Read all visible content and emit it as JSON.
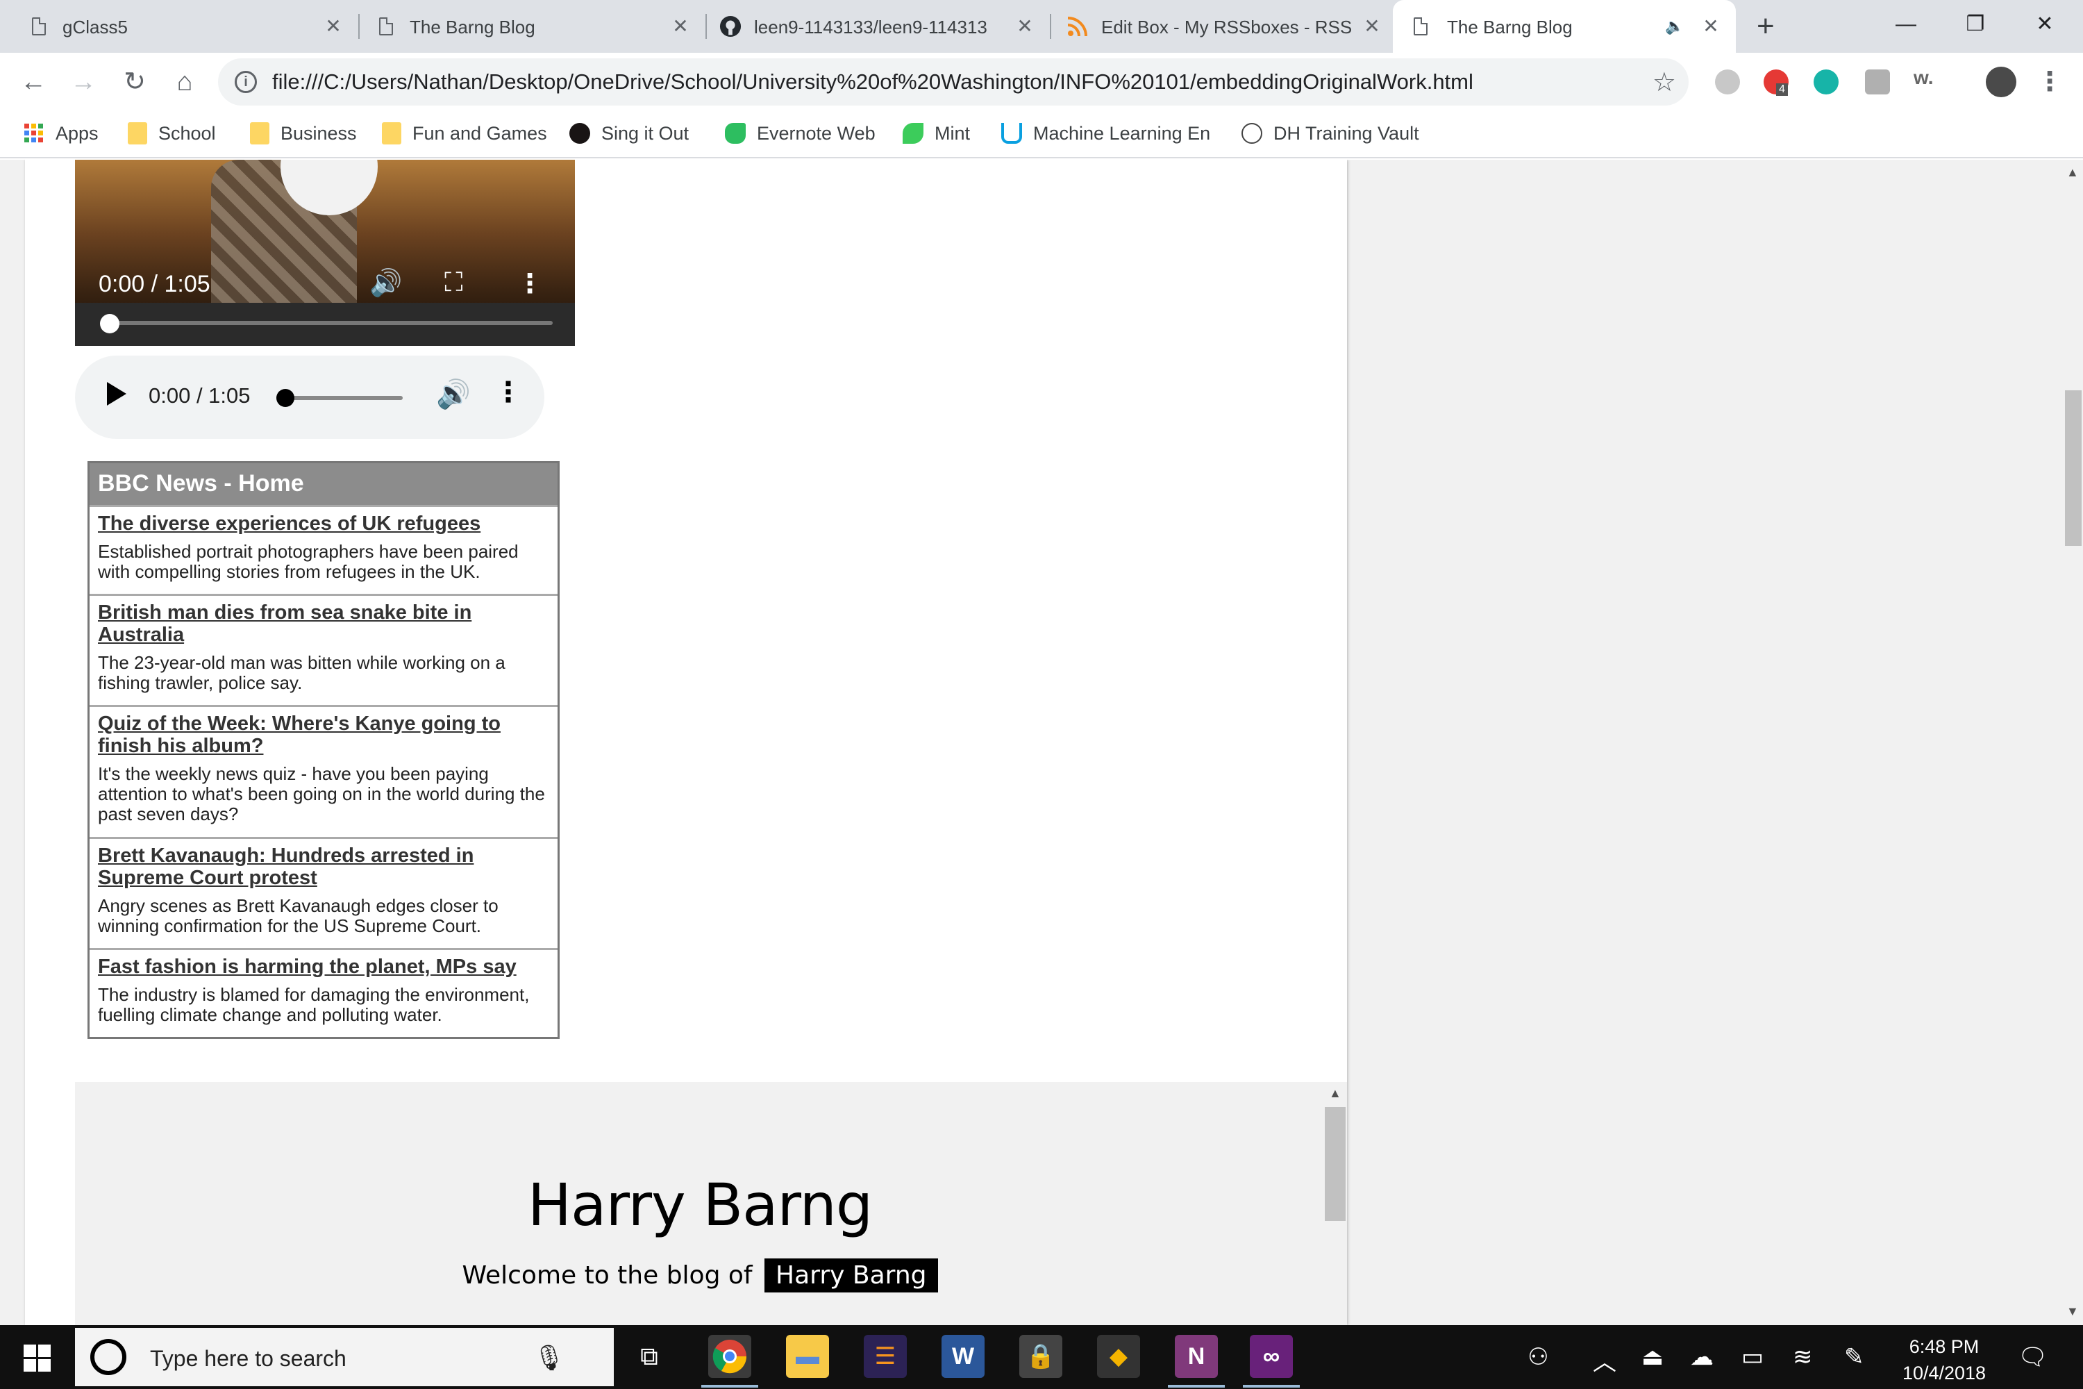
{
  "tabs": [
    {
      "title": "gClass5"
    },
    {
      "title": "The Barng Blog"
    },
    {
      "title": "leen9-1143133/leen9-114313"
    },
    {
      "title": "Edit Box - My RSSboxes - RSS"
    },
    {
      "title": "The Barng Blog"
    }
  ],
  "address_bar": {
    "url": "file:///C:/Users/Nathan/Desktop/OneDrive/School/University%20of%20Washington/INFO%20101/embeddingOriginalWork.html"
  },
  "bookmarks": [
    {
      "label": "Apps"
    },
    {
      "label": "School"
    },
    {
      "label": "Business"
    },
    {
      "label": "Fun and Games"
    },
    {
      "label": "Sing it Out"
    },
    {
      "label": "Evernote Web"
    },
    {
      "label": "Mint"
    },
    {
      "label": "Machine Learning En"
    },
    {
      "label": "DH Training Vault"
    }
  ],
  "extensions": {
    "badge_count": "4",
    "w_label": "w."
  },
  "video": {
    "time": "0:00 / 1:05",
    "progress": 0.0
  },
  "audio": {
    "time": "0:00 / 1:05",
    "progress": 0.0
  },
  "rss": {
    "title": "BBC News - Home",
    "items": [
      {
        "title": "The diverse experiences of UK refugees",
        "desc": "Established portrait photographers have been paired with compelling stories from refugees in the UK."
      },
      {
        "title": "British man dies from sea snake bite in Australia",
        "desc": "The 23-year-old man was bitten while working on a fishing trawler, police say."
      },
      {
        "title": "Quiz of the Week: Where's Kanye going to finish his album?",
        "desc": "It's the weekly news quiz - have you been paying attention to what's been going on in the world during the past seven days?"
      },
      {
        "title": "Brett Kavanaugh: Hundreds arrested in Supreme Court protest",
        "desc": "Angry scenes as Brett Kavanaugh edges closer to winning confirmation for the US Supreme Court."
      },
      {
        "title": "Fast fashion is harming the planet, MPs say",
        "desc": "The industry is blamed for damaging the environment, fuelling climate change and polluting water."
      }
    ]
  },
  "blog": {
    "name": "Harry Barng",
    "welcome_prefix": "Welcome to the blog of",
    "welcome_name": "Harry Barng"
  },
  "taskbar": {
    "search_placeholder": "Type here to search",
    "time": "6:48 PM",
    "date": "10/4/2018"
  }
}
